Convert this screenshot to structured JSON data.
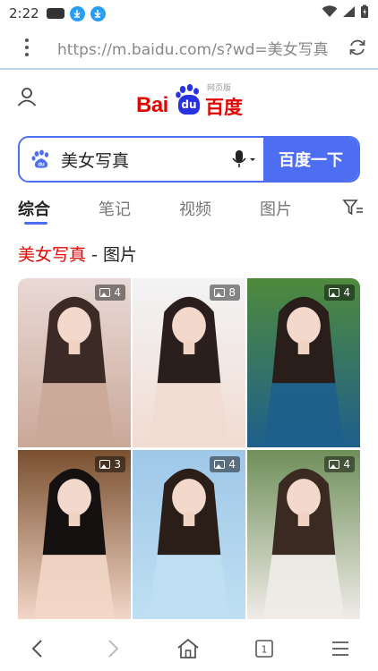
{
  "status_bar": {
    "time": "2:22"
  },
  "browser": {
    "url": "https://m.baidu.com/s?wd=美女写真"
  },
  "logo": {
    "text_bai": "Bai",
    "text_du": "du",
    "text_cn": "百度",
    "web_version": "网页版"
  },
  "search": {
    "query": "美女写真",
    "button_label": "百度一下"
  },
  "tabs": [
    {
      "label": "综合",
      "active": true
    },
    {
      "label": "笔记",
      "active": false
    },
    {
      "label": "视频",
      "active": false
    },
    {
      "label": "图片",
      "active": false
    }
  ],
  "section": {
    "highlight": "美女写真",
    "suffix": " - 图片"
  },
  "images": [
    {
      "count": "4",
      "palette": [
        "#e9d9d6",
        "#caa898",
        "#3b2a25"
      ]
    },
    {
      "count": "8",
      "palette": [
        "#f3f3f5",
        "#f1dcd2",
        "#2b1f1d"
      ]
    },
    {
      "count": "4",
      "palette": [
        "#4f8a3c",
        "#1e5f8c",
        "#2a1e1a"
      ]
    },
    {
      "count": "3",
      "palette": [
        "#7a5030",
        "#f2d6c7",
        "#151111"
      ]
    },
    {
      "count": "4",
      "palette": [
        "#9fc7e8",
        "#bfe0f2",
        "#2b1d18"
      ]
    },
    {
      "count": "4",
      "palette": [
        "#6f8f5a",
        "#f0ece8",
        "#3b2a22"
      ]
    }
  ],
  "colors": {
    "accent": "#4e6ef2",
    "brand_red": "#e10601",
    "brand_blue": "#2932e1"
  }
}
